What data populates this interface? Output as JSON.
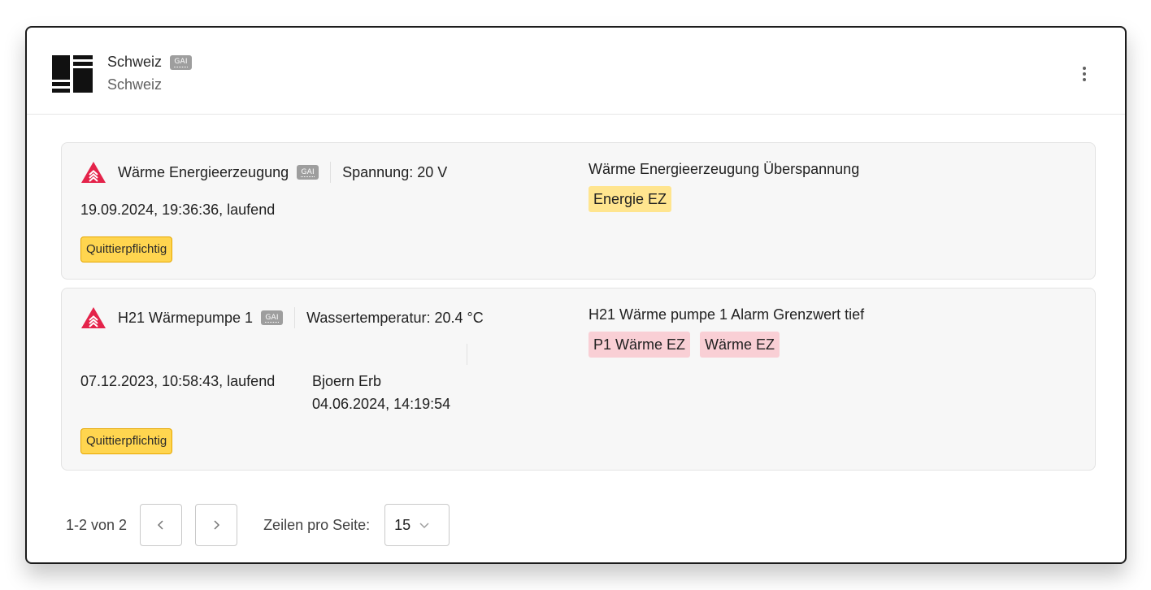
{
  "header": {
    "title": "Schweiz",
    "badge": "GAI",
    "subtitle": "Schweiz",
    "icon": "building-grid-icon",
    "menu_icon": "more-vertical-icon"
  },
  "alarms": [
    {
      "severity_icon": "alarm-warning-icon",
      "severity_color": "#e4234a",
      "device": "Wärme Energieerzeugung",
      "badge": "GAI",
      "measurement": "Spannung: 20 V",
      "time": "19.09.2024, 19:36:36, laufend",
      "status": "Quittierpflichtig",
      "description": "Wärme Energieerzeugung Überspannung",
      "tags": [
        "Energie EZ"
      ],
      "tag_color": "#ffe58f"
    },
    {
      "severity_icon": "alarm-warning-icon",
      "severity_color": "#e4234a",
      "device": "H21 Wärmepumpe 1",
      "badge": "GAI",
      "measurement": "Wassertemperatur: 20.4 °C",
      "time": "07.12.2023, 10:58:43, laufend",
      "acknowledged_by": "Bjoern Erb",
      "acknowledged_at": "04.06.2024, 14:19:54",
      "status": "Quittierpflichtig",
      "description": "H21 Wärme pumpe 1 Alarm Grenzwert tief",
      "tags": [
        "P1 Wärme EZ",
        "Wärme EZ"
      ],
      "tag_color": "#f9cfd5"
    }
  ],
  "pagination": {
    "range": "1-2 von 2",
    "prev_icon": "chevron-left-icon",
    "next_icon": "chevron-right-icon",
    "rows_label": "Zeilen pro Seite:",
    "rows_value": "15",
    "rows_icon": "chevron-down-icon"
  },
  "colors": {
    "warning": "#e4234a",
    "status_badge": "#ffd54f",
    "tag_yellow": "#ffe58f",
    "tag_pink": "#f9cfd5",
    "gai_badge": "#9e9e9e"
  }
}
